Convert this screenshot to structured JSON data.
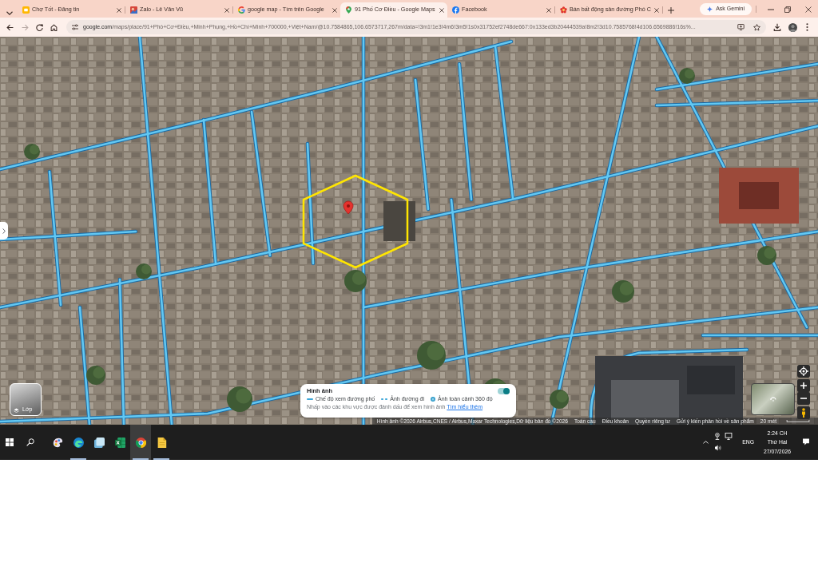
{
  "browser": {
    "tabs": [
      {
        "kind": "square",
        "title": "Chợ Tốt - Đăng tin",
        "selected": false
      },
      {
        "kind": "picture",
        "title": "Zalo - Lê Văn Vũ",
        "selected": false
      },
      {
        "kind": "g",
        "title": "google map - Tìm trên Google",
        "selected": false
      },
      {
        "kind": "pin",
        "title": "91 Phố Cơ Điều - Google Maps",
        "selected": true
      },
      {
        "kind": "f",
        "title": "Facebook",
        "selected": false
      },
      {
        "kind": "flower",
        "title": "Bán bất động sản đường Phó C",
        "selected": false
      }
    ],
    "gemini_button": "Ask Gemini",
    "url_host": "google.com",
    "url_path": "/maps/place/91+Phó+Cơ+Điều,+Minh+Phụng,+Hồ+Chí+Minh+700000,+Việt+Nam/@10.7584865,106.6573717,267m/data=!3m1!1e3!4m6!3m5!1s0x31752ef2748de667:0x133ed3b20444539a!8m2!3d10.7585768!4d106.6569886!16s%..."
  },
  "map": {
    "layers_button": "Lớp",
    "imagery": {
      "title": "Hình ảnh",
      "on": true,
      "legend": [
        {
          "kind": "line",
          "label": "Chế độ xem đường phố"
        },
        {
          "kind": "dashes",
          "label": "Ảnh đường đi"
        },
        {
          "kind": "sphere",
          "label": "Ảnh toàn cảnh 360 độ"
        }
      ],
      "hint": "Nhấp vào các khu vực được đánh dấu để xem hình ảnh",
      "link": "Tìm hiểu thêm"
    },
    "attribution": "Hình ảnh ©2026 Airbus,CNES / Airbus,Maxar Technologies,Dữ liệu bản đồ ©2026",
    "footer_links": [
      "Toàn cầu",
      "Điều khoản",
      "Quyền riêng tư",
      "Gửi ý kiến phản hồi về sản phẩm"
    ],
    "scale": "20 mét"
  },
  "taskbar": {
    "apps": [
      {
        "kind": "palette",
        "running": false,
        "selected": false
      },
      {
        "kind": "swirl",
        "running": true,
        "selected": false
      },
      {
        "kind": "tile",
        "running": false,
        "selected": false
      },
      {
        "kind": "sheet",
        "running": false,
        "selected": false
      },
      {
        "kind": "browser",
        "running": true,
        "selected": true
      },
      {
        "kind": "note",
        "running": true,
        "selected": false
      }
    ],
    "language": "ENG",
    "time": "2:24 CH",
    "day": "Thứ Hai",
    "date": "27/07/2026"
  }
}
